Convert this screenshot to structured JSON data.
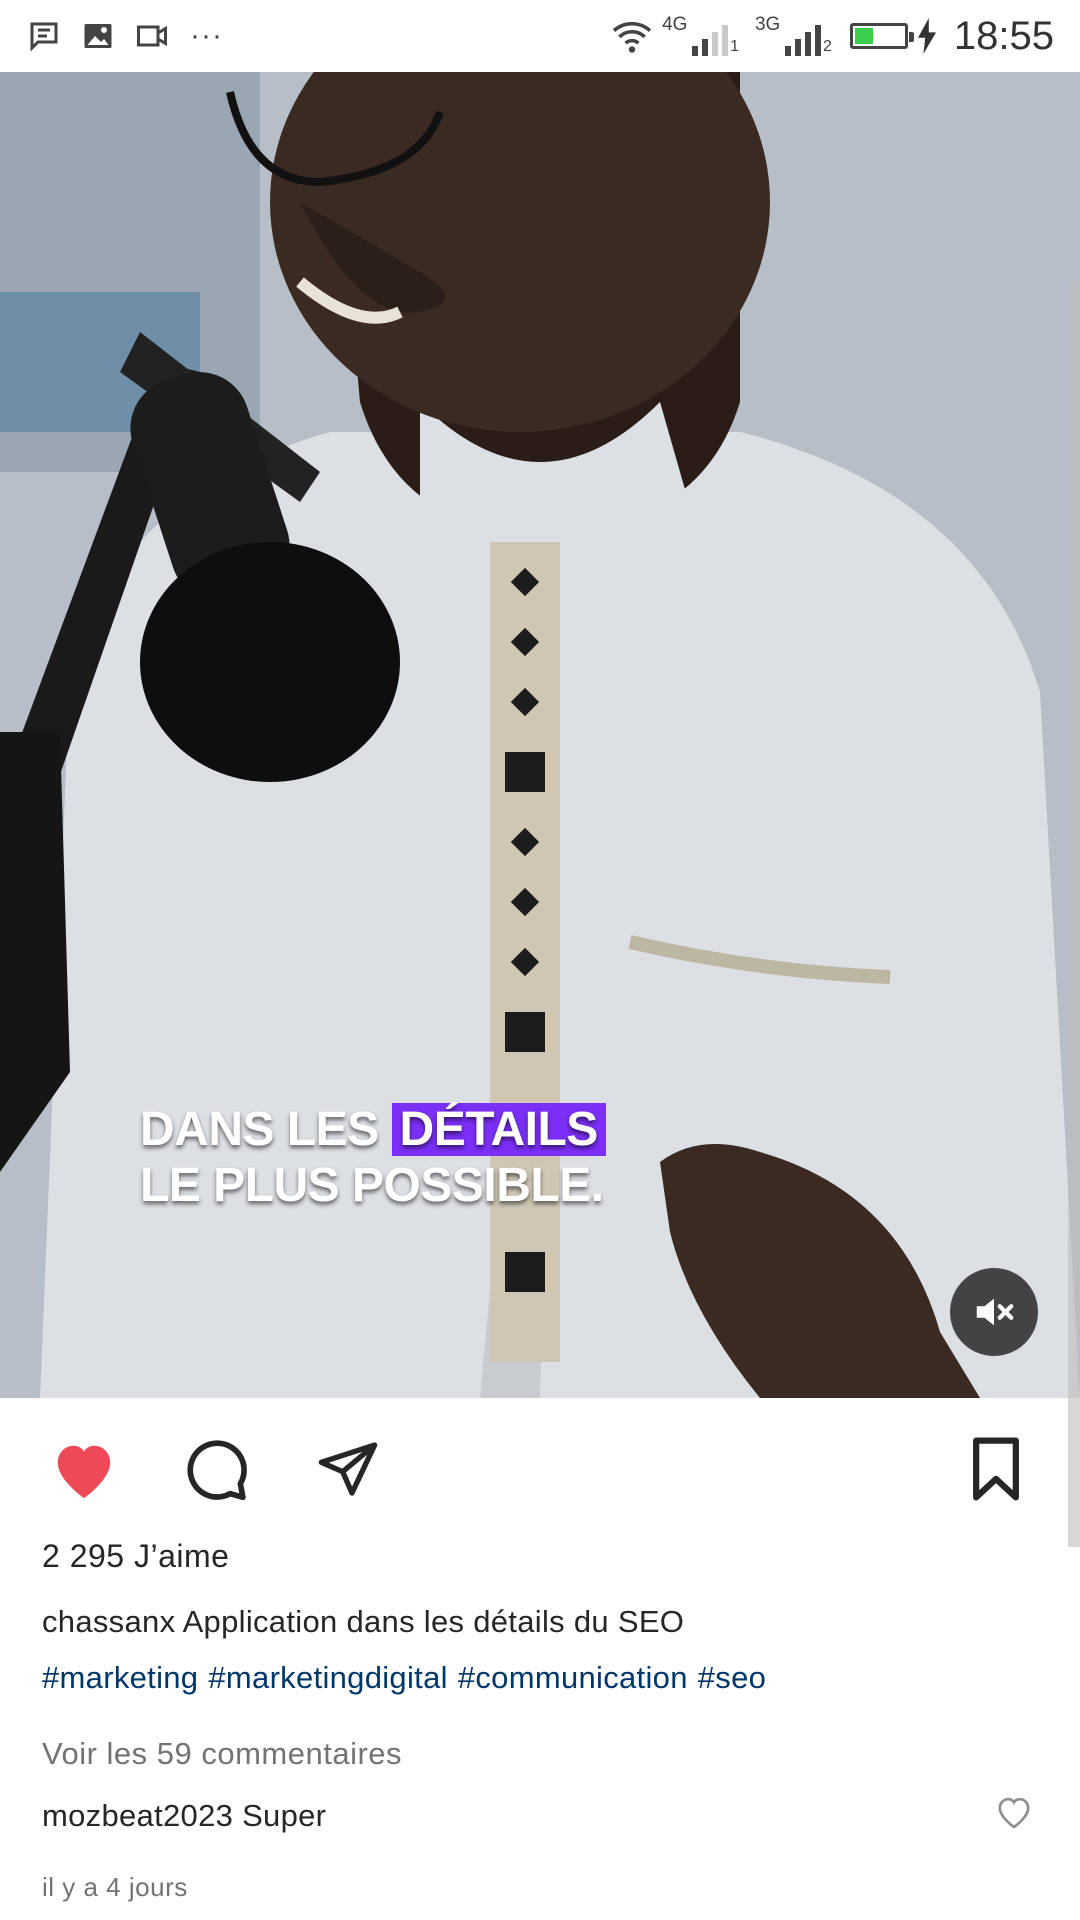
{
  "status_bar": {
    "more": "···",
    "network1": {
      "type": "4G",
      "sim": "1"
    },
    "network2": {
      "type": "3G",
      "sim": "2"
    },
    "battery_level_percent": 30,
    "battery_color": "#3ccf4e",
    "time": "18:55"
  },
  "media": {
    "caption_line1_part1": "DANS LES ",
    "caption_line1_highlight": "DÉTAILS",
    "caption_line2": "LE PLUS POSSIBLE.",
    "highlight_color": "#7b2ff7",
    "muted": true
  },
  "actions": {
    "liked": true,
    "like_color": "#ed4956",
    "icons": [
      "heart-icon",
      "comment-icon",
      "share-icon",
      "bookmark-icon"
    ]
  },
  "post": {
    "likes_text": "2 295 J’aime",
    "username": "chassanx",
    "caption_text": " Application dans les détails du SEO",
    "hashtags": [
      "#marketing",
      "#marketingdigital",
      "#communication",
      "#seo"
    ],
    "view_comments": "Voir les 59 commentaires",
    "comment_user": "mozbeat2023",
    "comment_text": " Super",
    "timestamp": "il y a 4 jours"
  }
}
